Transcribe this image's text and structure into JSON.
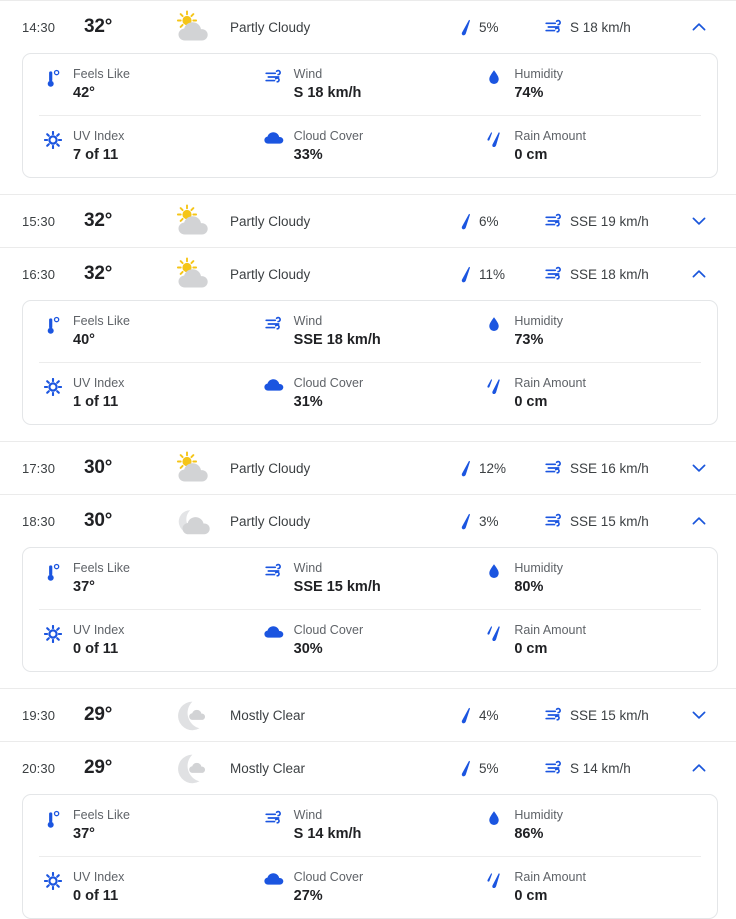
{
  "labels": {
    "feels_like": "Feels Like",
    "wind": "Wind",
    "humidity": "Humidity",
    "uv_index": "UV Index",
    "cloud_cover": "Cloud Cover",
    "rain_amount": "Rain Amount"
  },
  "colors": {
    "accent_blue": "#1a56db",
    "icon_blue": "#1b55e0",
    "sun_yellow": "#f5c518",
    "cloud_gray": "#d2d3d5",
    "text_primary": "#202124",
    "text_secondary": "#5f6368",
    "divider": "#ebebeb",
    "card_border": "#e4e6e8"
  },
  "hours": [
    {
      "time": "14:30",
      "temp": "32°",
      "condition": "Partly Cloudy",
      "condition_icon": "sun-behind-cloud-icon",
      "precip": "5%",
      "wind": "S 18 km/h",
      "expanded": true,
      "toggle_icon": "chevron-up-icon",
      "details": {
        "feels_like": "42°",
        "wind": "S 18 km/h",
        "humidity": "74%",
        "uv_index": "7 of 11",
        "cloud_cover": "33%",
        "rain_amount": "0 cm"
      }
    },
    {
      "time": "15:30",
      "temp": "32°",
      "condition": "Partly Cloudy",
      "condition_icon": "sun-behind-cloud-icon",
      "precip": "6%",
      "wind": "SSE 19 km/h",
      "expanded": false,
      "toggle_icon": "chevron-down-icon",
      "details": null
    },
    {
      "time": "16:30",
      "temp": "32°",
      "condition": "Partly Cloudy",
      "condition_icon": "sun-behind-cloud-icon",
      "precip": "11%",
      "wind": "SSE 18 km/h",
      "expanded": true,
      "toggle_icon": "chevron-up-icon",
      "details": {
        "feels_like": "40°",
        "wind": "SSE 18 km/h",
        "humidity": "73%",
        "uv_index": "1 of 11",
        "cloud_cover": "31%",
        "rain_amount": "0 cm"
      }
    },
    {
      "time": "17:30",
      "temp": "30°",
      "condition": "Partly Cloudy",
      "condition_icon": "sun-behind-cloud-icon",
      "precip": "12%",
      "wind": "SSE 16 km/h",
      "expanded": false,
      "toggle_icon": "chevron-down-icon",
      "details": null
    },
    {
      "time": "18:30",
      "temp": "30°",
      "condition": "Partly Cloudy",
      "condition_icon": "moon-behind-cloud-icon",
      "precip": "3%",
      "wind": "SSE 15 km/h",
      "expanded": true,
      "toggle_icon": "chevron-up-icon",
      "details": {
        "feels_like": "37°",
        "wind": "SSE 15 km/h",
        "humidity": "80%",
        "uv_index": "0 of 11",
        "cloud_cover": "30%",
        "rain_amount": "0 cm"
      }
    },
    {
      "time": "19:30",
      "temp": "29°",
      "condition": "Mostly Clear",
      "condition_icon": "moon-mostly-clear-icon",
      "precip": "4%",
      "wind": "SSE 15 km/h",
      "expanded": false,
      "toggle_icon": "chevron-down-icon",
      "details": null
    },
    {
      "time": "20:30",
      "temp": "29°",
      "condition": "Mostly Clear",
      "condition_icon": "moon-mostly-clear-icon",
      "precip": "5%",
      "wind": "S 14 km/h",
      "expanded": true,
      "toggle_icon": "chevron-up-icon",
      "details": {
        "feels_like": "37°",
        "wind": "S 14 km/h",
        "humidity": "86%",
        "uv_index": "0 of 11",
        "cloud_cover": "27%",
        "rain_amount": "0 cm"
      }
    }
  ]
}
